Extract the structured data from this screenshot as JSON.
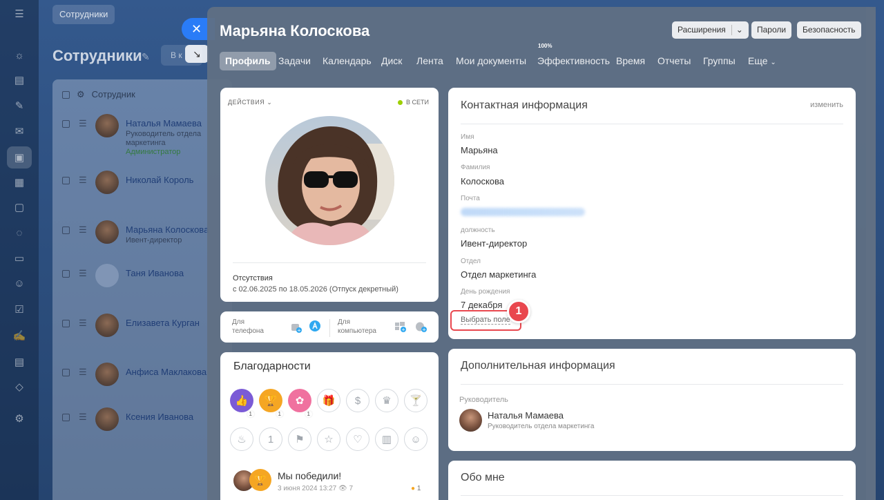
{
  "background": {
    "tag": "Сотрудники",
    "title": "Сотрудники",
    "filter_text": "В к",
    "list_header": "Сотрудник",
    "employees": [
      {
        "name": "Наталья Мамаева",
        "role": "Руководитель отдела маркетинга",
        "badge": "Администратор"
      },
      {
        "name": "Николай Король",
        "role": "",
        "badge": ""
      },
      {
        "name": "Марьяна Колосковa",
        "role": "Ивент-директор",
        "badge": ""
      },
      {
        "name": "Таня Иванова",
        "role": "",
        "badge": ""
      },
      {
        "name": "Елизавета Курган",
        "role": "",
        "badge": ""
      },
      {
        "name": "Анфиса Маклакова",
        "role": "",
        "badge": ""
      },
      {
        "name": "Ксения Иванова",
        "role": "",
        "badge": ""
      }
    ]
  },
  "panel": {
    "title": "Марьяна Колоскова",
    "buttons": {
      "extensions": "Расширения",
      "passwords": "Пароли",
      "security": "Безопасность"
    },
    "tabs": [
      "Профиль",
      "Задачи",
      "Календарь",
      "Диск",
      "Лента",
      "Мои документы",
      "Эффективность",
      "Время",
      "Отчеты",
      "Группы",
      "Еще"
    ],
    "efficiency_badge": "100%"
  },
  "profile": {
    "actions": "ДЕЙСТВИЯ",
    "status": "В СЕТИ",
    "absences_title": "Отсутствия",
    "absences_text": "с 02.06.2025 по 18.05.2026 (Отпуск декретный)"
  },
  "apps": {
    "phone": "Для телефона",
    "computer": "Для компьютера"
  },
  "thanks": {
    "title": "Благодарности",
    "badges": [
      {
        "icon": "like-icon",
        "count": "1",
        "color": "#7b5bd6"
      },
      {
        "icon": "cup-icon",
        "count": "1",
        "color": "#f5a623"
      },
      {
        "icon": "flower-icon",
        "count": "1",
        "color": "#f0719f"
      }
    ],
    "post_title": "Мы победили!",
    "post_date": "3 июня 2024 13:27",
    "post_views": "7",
    "post_reactions": "1"
  },
  "contacts": {
    "title": "Контактная информация",
    "edit": "изменить",
    "fields": [
      {
        "label": "Имя",
        "value": "Марьяна"
      },
      {
        "label": "Фамилия",
        "value": "Колоскова"
      },
      {
        "label": "Почта",
        "value": ""
      },
      {
        "label": "должность",
        "value": "Ивент-директор"
      },
      {
        "label": "Отдел",
        "value": "Отдел маркетинга"
      },
      {
        "label": "День рождения",
        "value": "7 декабря"
      }
    ],
    "pick_field": "Выбрать поле",
    "marker": "1"
  },
  "additional": {
    "title": "Дополнительная информация",
    "manager_label": "Руководитель",
    "manager_name": "Наталья Мамаева",
    "manager_role": "Руководитель отдела маркетинга"
  },
  "about": {
    "title": "Обо мне"
  }
}
